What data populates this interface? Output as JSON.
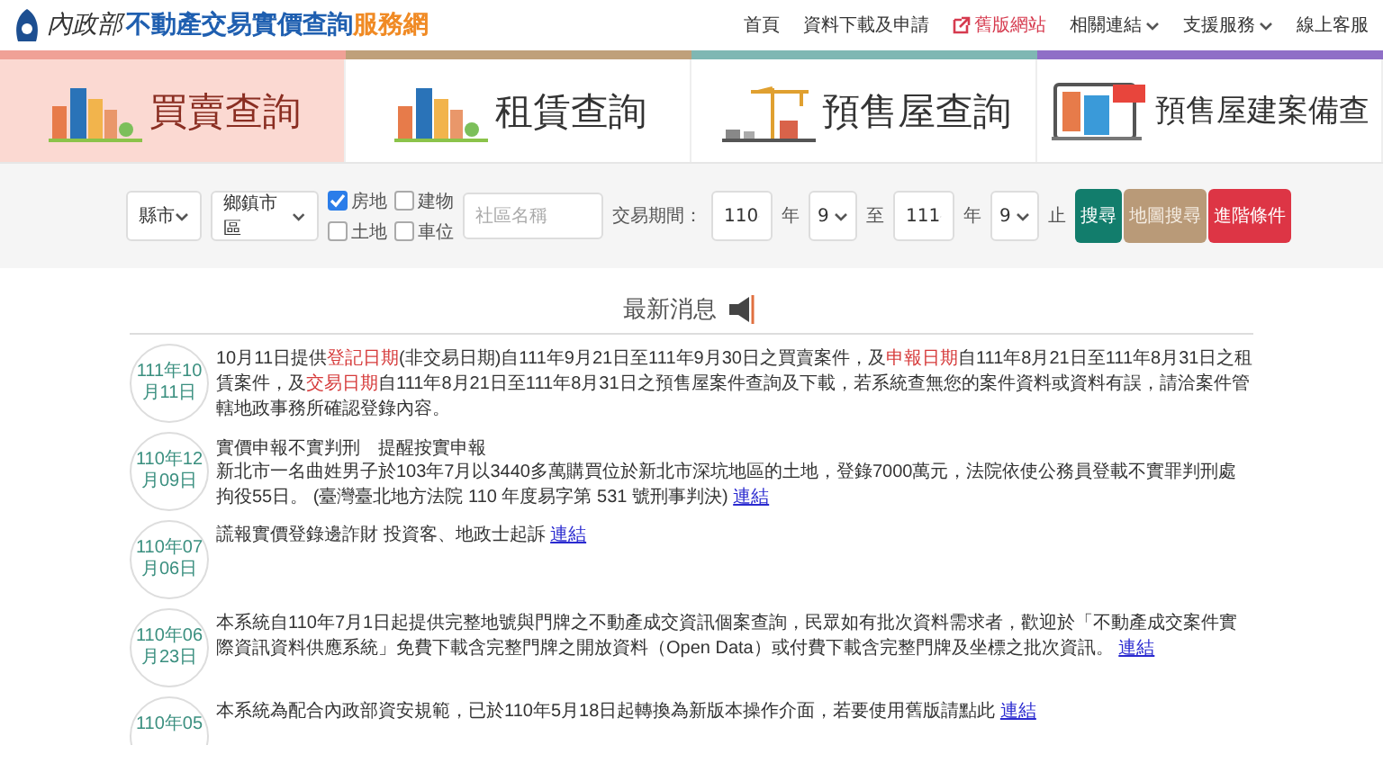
{
  "header": {
    "org": "內政部",
    "title": "不動產交易實價查詢",
    "title_suffix": "服務網",
    "nav": [
      {
        "label": "首頁",
        "kind": "plain"
      },
      {
        "label": "資料下載及申請",
        "kind": "plain"
      },
      {
        "label": "舊版網站",
        "kind": "external"
      },
      {
        "label": "相關連結",
        "kind": "dropdown"
      },
      {
        "label": "支援服務",
        "kind": "dropdown"
      },
      {
        "label": "線上客服",
        "kind": "plain"
      }
    ]
  },
  "tabs": [
    {
      "label": "買賣查詢",
      "selected": true,
      "color": "#f0a196",
      "kind": "city"
    },
    {
      "label": "租賃查詢",
      "selected": false,
      "color": "#bfa07a",
      "kind": "city"
    },
    {
      "label": "預售屋查詢",
      "selected": false,
      "color": "#7fb7b3",
      "kind": "crane"
    },
    {
      "label": "預售屋建案備查",
      "selected": false,
      "color": "#8f6fc7",
      "kind": "billboard"
    }
  ],
  "filters": {
    "county": {
      "value": "縣市"
    },
    "district": {
      "value": "鄉鎮市區"
    },
    "types": [
      {
        "label": "房地",
        "checked": true
      },
      {
        "label": "建物",
        "checked": false
      },
      {
        "label": "土地",
        "checked": false
      },
      {
        "label": "車位",
        "checked": false
      }
    ],
    "community": {
      "placeholder": "社區名稱"
    },
    "period_label": "交易期間：",
    "from_year": "110",
    "year_unit_1": "年",
    "from_month": "9",
    "to_word": "至",
    "to_year": "111",
    "year_unit_2": "年",
    "to_month": "9",
    "end_word": "止",
    "buttons": [
      {
        "label": "搜尋",
        "kind": "primary"
      },
      {
        "label": "地圖搜尋",
        "kind": "map"
      },
      {
        "label": "進階條件",
        "kind": "advanced"
      }
    ]
  },
  "news": {
    "title": "最新消息",
    "items": [
      {
        "date": "111年10月11日",
        "segments": [
          {
            "text": "10月11日提供",
            "highlight": false
          },
          {
            "text": "登記日期",
            "highlight": true
          },
          {
            "text": "(非交易日期)自111年9月21日至111年9月30日之買賣案件，及",
            "highlight": false
          },
          {
            "text": "申報日期",
            "highlight": true
          },
          {
            "text": "自111年8月21日至111年8月31日之租賃案件，及",
            "highlight": false
          },
          {
            "text": "交易日期",
            "highlight": true
          },
          {
            "text": "自111年8月21日至111年8月31日之預售屋案件查詢及下載，若系統查無您的案件資料或資料有誤，請洽案件管轄地政事務所確認登錄內容。",
            "highlight": false
          }
        ]
      },
      {
        "date": "110年12月09日",
        "heading": "實價申報不實判刑　提醒按實申報",
        "segments": [
          {
            "text": "新北市一名曲姓男子於103年7月以3440多萬購買位於新北市深坑地區的土地，登錄7000萬元，法院依使公務員登載不實罪判刑處拘役55日。 (臺灣臺北地方法院 110 年度易字第 531 號刑事判決)",
            "highlight": false
          }
        ],
        "link": "連結"
      },
      {
        "date": "110年07月06日",
        "segments": [
          {
            "text": "謊報實價登錄邊詐財 投資客、地政士起訴",
            "highlight": false
          }
        ],
        "link": "連結"
      },
      {
        "date": "110年06月23日",
        "segments": [
          {
            "text": "本系統自110年7月1日起提供完整地號與門牌之不動產成交資訊個案查詢，民眾如有批次資料需求者，歡迎於「不動產成交案件實際資訊資料供應系統」免費下載含完整門牌之開放資料（Open Data）或付費下載含完整門牌及坐標之批次資訊。",
            "highlight": false
          }
        ],
        "link": "連結"
      },
      {
        "date": "110年05",
        "segments": [
          {
            "text": "本系統為配合內政部資安規範，已於110年5月18日起轉換為新版本操作介面，若要使用舊版請點此",
            "highlight": false
          }
        ],
        "link": "連結"
      }
    ]
  }
}
